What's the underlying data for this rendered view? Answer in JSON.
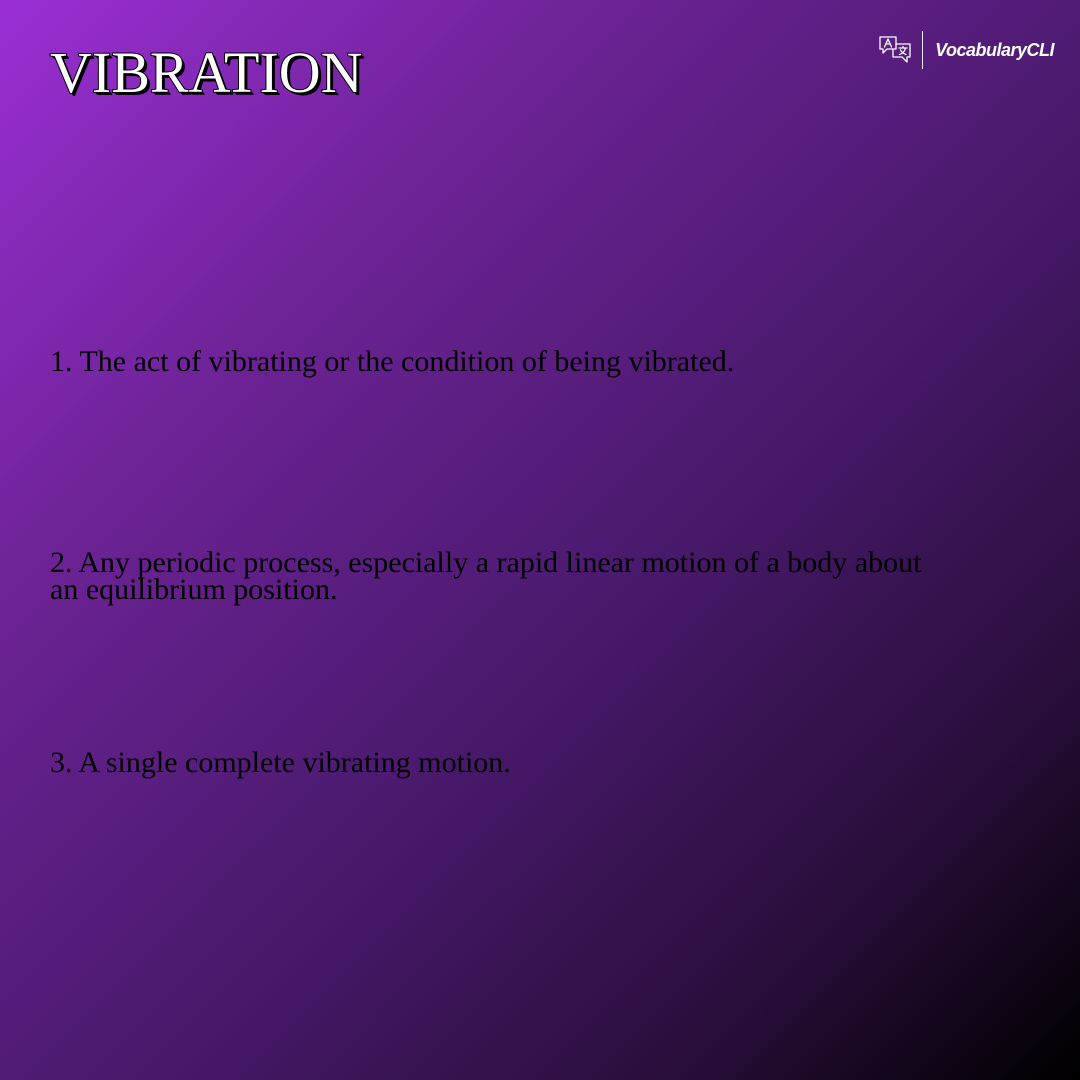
{
  "word": "VIBRATION",
  "brand": {
    "name": "VocabularyCLI",
    "icon": "translate-icon"
  },
  "definitions": [
    {
      "text": "1. The act of vibrating or the condition of being vibrated."
    },
    {
      "text": "2. Any periodic process, especially a rapid linear motion of a body about an equilibrium position."
    },
    {
      "text": "3. A single complete vibrating motion."
    }
  ],
  "colors": {
    "gradient_start": "#9a2fd4",
    "gradient_end": "#000000",
    "title_fill": "#ffffff",
    "title_outline": "#000000",
    "definition_text": "#000000",
    "brand_text": "#ffffff"
  }
}
